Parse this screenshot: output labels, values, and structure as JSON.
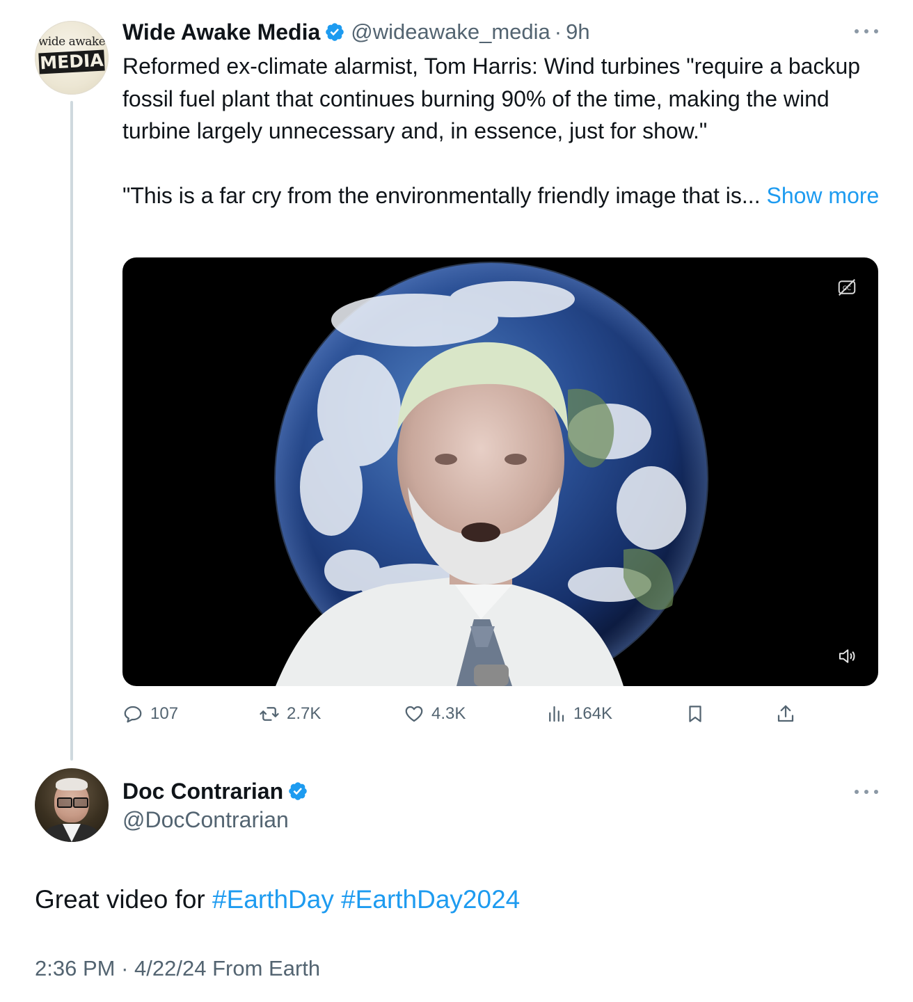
{
  "original_tweet": {
    "author": {
      "name": "Wide Awake Media",
      "handle": "@wideawake_media",
      "verified": true,
      "avatar_text_top": "wide awake",
      "avatar_text_bottom": "MEDIA"
    },
    "separator": "·",
    "time_ago": "9h",
    "text_paragraph_1": "Reformed ex-climate alarmist, Tom Harris: Wind turbines \"require a backup fossil fuel plant that continues burning 90% of the time, making the wind turbine largely unnecessary and, in essence, just for show.\"",
    "text_paragraph_2": "\"This is a far cry from the environmentally friendly image that is...",
    "show_more_label": "Show more",
    "media": {
      "type": "video",
      "cc_icon": "closed-captions-off-icon",
      "sound_icon": "volume-icon"
    },
    "actions": {
      "replies": "107",
      "reposts": "2.7K",
      "likes": "4.3K",
      "views": "164K"
    },
    "more_icon": "more-options-icon"
  },
  "reply": {
    "author": {
      "name": "Doc Contrarian",
      "handle": "@DocContrarian",
      "verified": true
    },
    "text_prefix": "Great video for",
    "hashtags": [
      "#EarthDay",
      "#EarthDay2024"
    ],
    "timestamp": "2:36 PM",
    "date": "4/22/24",
    "location": "From Earth",
    "separator": "·"
  },
  "colors": {
    "accent": "#1d9bf0",
    "text": "#0f1419",
    "secondary": "#536471",
    "thread_line": "#cfd9de"
  }
}
